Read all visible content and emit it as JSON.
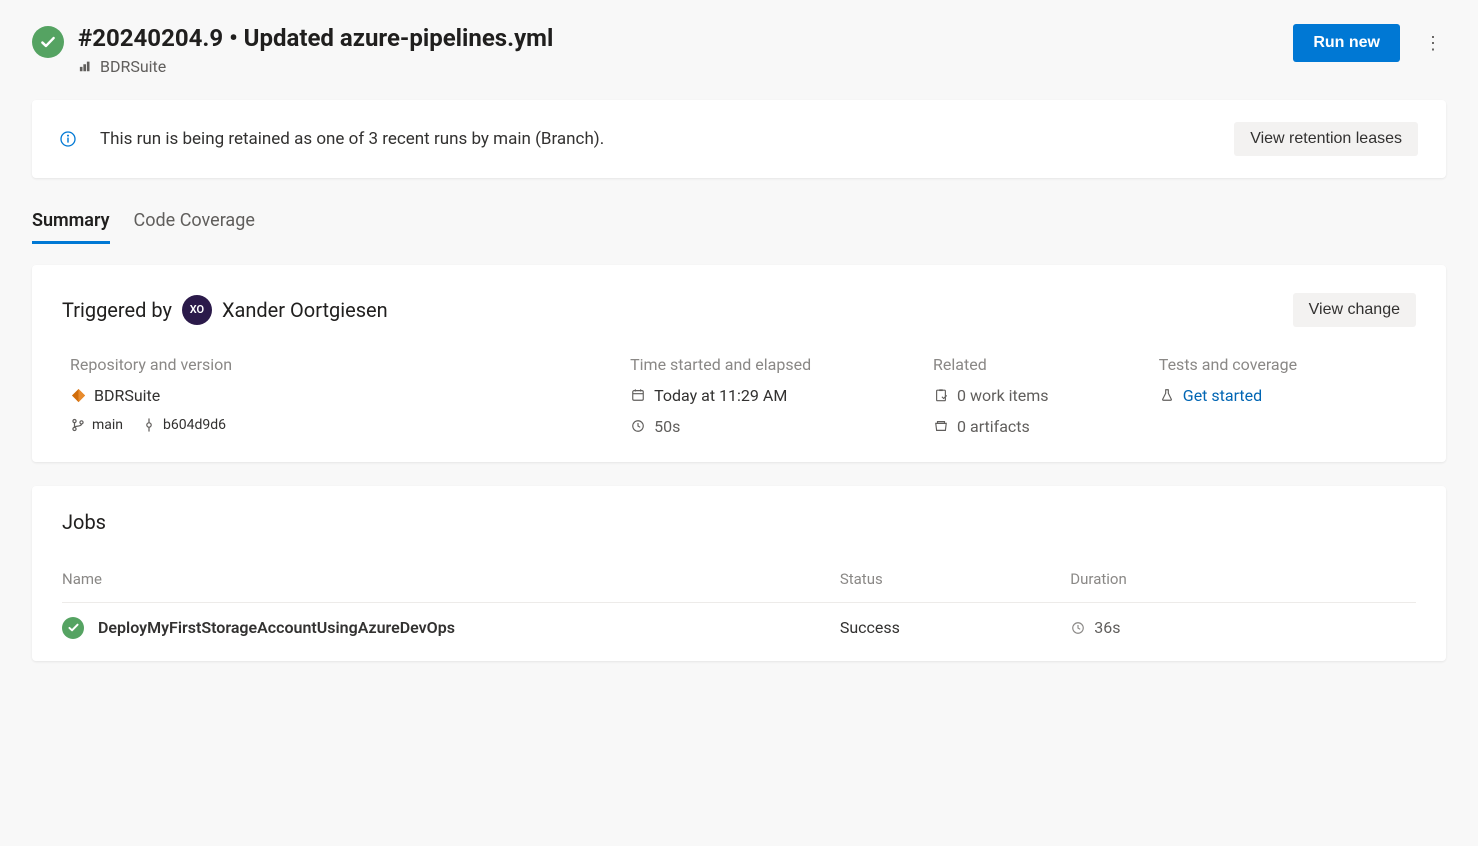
{
  "header": {
    "title": "#20240204.9 • Updated azure-pipelines.yml",
    "pipeline_name": "BDRSuite",
    "run_new_label": "Run new"
  },
  "retention": {
    "message": "This run is being retained as one of 3 recent runs by main (Branch).",
    "button_label": "View retention leases"
  },
  "tabs": {
    "summary": "Summary",
    "code_coverage": "Code Coverage"
  },
  "triggered": {
    "prefix": "Triggered by",
    "avatar_initials": "XO",
    "user_name": "Xander Oortgiesen",
    "view_change_label": "View change"
  },
  "details": {
    "repo_label": "Repository and version",
    "repo_name": "BDRSuite",
    "branch_name": "main",
    "commit_hash": "b604d9d6",
    "time_label": "Time started and elapsed",
    "time_started": "Today at 11:29 AM",
    "elapsed": "50s",
    "related_label": "Related",
    "work_items": "0 work items",
    "artifacts": "0 artifacts",
    "tests_label": "Tests and coverage",
    "tests_link": "Get started"
  },
  "jobs": {
    "title": "Jobs",
    "columns": {
      "name": "Name",
      "status": "Status",
      "duration": "Duration"
    },
    "rows": [
      {
        "name": "DeployMyFirstStorageAccountUsingAzureDevOps",
        "status": "Success",
        "duration": "36s"
      }
    ]
  }
}
